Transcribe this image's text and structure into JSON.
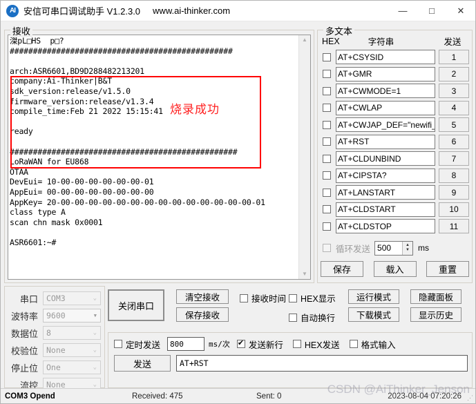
{
  "window": {
    "logo_text": "AI",
    "title": "安信可串口调试助手 V1.2.3.0",
    "url": "www.ai-thinker.com",
    "minimize": "—",
    "maximize": "□",
    "close": "✕"
  },
  "receive": {
    "group_label": "接收",
    "text": "滐pL□HS  p□?\n################################################\n\narch:ASR6601,BD9D288482213201\ncompany:Ai-Thinker|B&T\nsdk_version:release/v1.5.0\nfirmware_version:release/v1.3.4\ncompile_time:Feb 21 2022 15:15:41\n\nready\n\n#################################################\nLoRaWAN for EU868\nOTAA\nDevEui= 10-00-00-00-00-00-00-01\nAppEui= 00-00-00-00-00-00-00-00\nAppKey= 20-00-00-00-00-00-00-00-00-00-00-00-00-00-00-01\nclass type A\nscan chn mask 0x0001\n\nASR6601:~#",
    "annotation": "烧录成功",
    "scroll_up": "▲",
    "scroll_down": "▼"
  },
  "multitext": {
    "group_label": "多文本",
    "header_hex": "HEX",
    "header_string": "字符串",
    "header_send": "发送",
    "commands": [
      {
        "hex": false,
        "value": "AT+CSYSID",
        "send": "1"
      },
      {
        "hex": false,
        "value": "AT+GMR",
        "send": "2"
      },
      {
        "hex": false,
        "value": "AT+CWMODE=1",
        "send": "3"
      },
      {
        "hex": false,
        "value": "AT+CWLAP",
        "send": "4"
      },
      {
        "hex": false,
        "value": "AT+CWJAP_DEF=\"newifi_",
        "send": "5"
      },
      {
        "hex": false,
        "value": "AT+RST",
        "send": "6"
      },
      {
        "hex": false,
        "value": "AT+CLDUNBIND",
        "send": "7"
      },
      {
        "hex": false,
        "value": "AT+CIPSTA?",
        "send": "8"
      },
      {
        "hex": false,
        "value": "AT+LANSTART",
        "send": "9"
      },
      {
        "hex": false,
        "value": "AT+CLDSTART",
        "send": "10"
      },
      {
        "hex": false,
        "value": "AT+CLDSTOP",
        "send": "11"
      }
    ],
    "loop_label": "循环发送",
    "loop_checked": false,
    "loop_interval": "500",
    "loop_unit": "ms",
    "save_label": "保存",
    "load_label": "载入",
    "reset_label": "重置"
  },
  "serial": {
    "fields": [
      {
        "label": "串口",
        "value": "COM3"
      },
      {
        "label": "波特率",
        "value": "9600"
      },
      {
        "label": "数据位",
        "value": "8"
      },
      {
        "label": "校验位",
        "value": "None"
      },
      {
        "label": "停止位",
        "value": "One"
      },
      {
        "label": "流控",
        "value": "None"
      }
    ]
  },
  "controls": {
    "close_port": "关闭串口",
    "clear_recv": "清空接收",
    "save_recv": "保存接收",
    "recv_time_label": "接收时间",
    "recv_time_checked": false,
    "hex_show_label": "HEX显示",
    "hex_show_checked": false,
    "auto_newline_label": "自动换行",
    "auto_newline_checked": false,
    "run_mode": "运行模式",
    "download_mode": "下载模式",
    "hide_panel": "隐藏面板",
    "show_history": "显示历史"
  },
  "send": {
    "timed_label": "定时发送",
    "timed_checked": false,
    "interval": "800",
    "interval_unit": "ms/次",
    "newline_label": "发送新行",
    "newline_checked": true,
    "hex_send_label": "HEX发送",
    "hex_send_checked": false,
    "format_input_label": "格式输入",
    "format_input_checked": false,
    "send_button": "发送",
    "send_value": "AT+RST"
  },
  "status": {
    "connection": "COM3 Opend",
    "received": "Received: 475",
    "sent": "Sent: 0",
    "timestamp": "2023-08-04 07:20:26",
    "grip": "⋰"
  },
  "watermark": "CSDN @AiThinker_Jenson"
}
